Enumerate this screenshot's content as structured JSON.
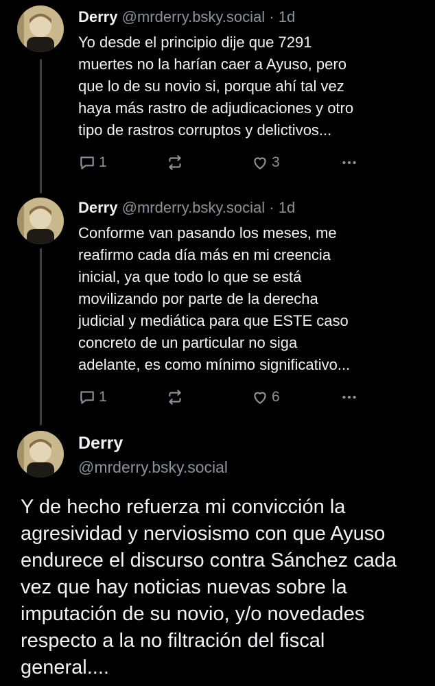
{
  "posts": [
    {
      "name": "Derry",
      "handle": "@mrderry.bsky.social",
      "separator": "·",
      "time": "1d",
      "lines": [
        "Yo desde el principio dije que 7291",
        "muertes no la harían caer a Ayuso, pero",
        "que lo de su novio si, porque ahí tal vez",
        "haya más rastro de adjudicaciones y otro",
        "tipo de rastros corruptos y delictivos..."
      ],
      "replies": "1",
      "likes": "3"
    },
    {
      "name": "Derry",
      "handle": "@mrderry.bsky.social",
      "separator": "·",
      "time": "1d",
      "lines": [
        "Conforme van pasando los meses, me",
        "reafirmo cada día más en mi creencia",
        "inicial, ya que todo lo que se está",
        "movilizando por parte de la derecha",
        "judicial y mediática para que ESTE caso",
        "concreto de un particular no siga",
        "adelante, es como mínimo significativo..."
      ],
      "replies": "1",
      "likes": "6"
    }
  ],
  "main_post": {
    "name": "Derry",
    "handle": "@mrderry.bsky.social",
    "lines": [
      "Y de hecho refuerza mi convicción la",
      "agresividad y nerviosismo con que Ayuso",
      "endurece el discurso contra Sánchez cada",
      "vez que hay noticias nuevas sobre la",
      "imputación de su novio, y/o novedades",
      "respecto a la no filtración del fiscal",
      "general...."
    ]
  },
  "icons": {
    "reply": "reply-icon",
    "repost": "repost-icon",
    "like": "heart-icon",
    "more": "more-dots-icon"
  }
}
